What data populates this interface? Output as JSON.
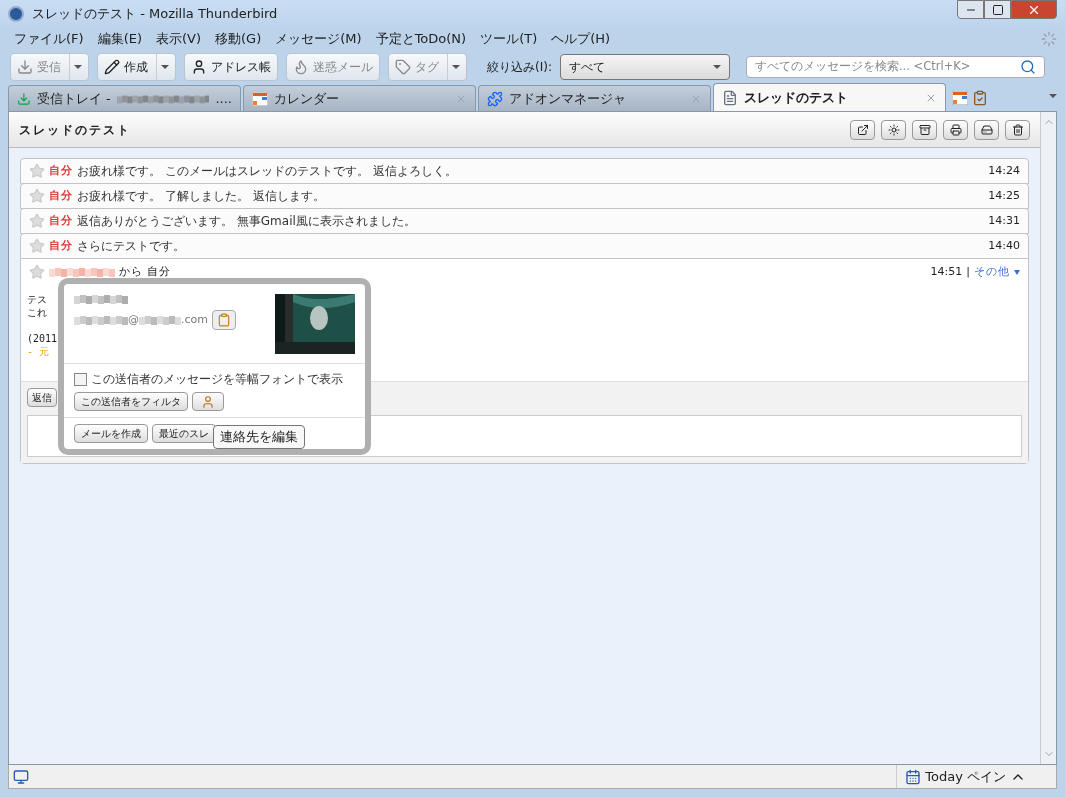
{
  "window": {
    "title": "スレッドのテスト - Mozilla Thunderbird"
  },
  "menu": [
    "ファイル(F)",
    "編集(E)",
    "表示(V)",
    "移動(G)",
    "メッセージ(M)",
    "予定とToDo(N)",
    "ツール(T)",
    "ヘルプ(H)"
  ],
  "toolbar": {
    "buttons": [
      {
        "kind": "get",
        "label": "受信",
        "disabled": true,
        "dropdown": true
      },
      {
        "kind": "write",
        "label": "作成",
        "disabled": false,
        "dropdown": true
      },
      {
        "kind": "address",
        "label": "アドレス帳",
        "disabled": false,
        "dropdown": false
      },
      {
        "kind": "junk",
        "label": "迷惑メール",
        "disabled": true,
        "dropdown": false
      },
      {
        "kind": "tag",
        "label": "タグ",
        "disabled": true,
        "dropdown": true
      }
    ],
    "filter_label": "絞り込み(I):",
    "filter_value": "すべて",
    "search_placeholder": "すべてのメッセージを検索... <Ctrl+K>"
  },
  "tabs": [
    {
      "kind": "inbox",
      "label": "受信トレイ -",
      "suffix": "....",
      "selected": false
    },
    {
      "kind": "calendar",
      "label": "カレンダー",
      "selected": false
    },
    {
      "kind": "addons",
      "label": "アドオンマネージャ",
      "selected": false
    },
    {
      "kind": "doc",
      "label": "スレッドのテスト",
      "selected": true
    }
  ],
  "thread": {
    "title": "スレッドのテスト",
    "messages": [
      {
        "sender": "自分",
        "snippet": "お疲れ様です。 このメールはスレッドのテストです。 返信よろしく。",
        "time": "14:24"
      },
      {
        "sender": "自分",
        "snippet": "お疲れ様です。 了解しました。 返信します。",
        "time": "14:25"
      },
      {
        "sender": "自分",
        "snippet": "返信ありがとうございます。 無事Gmail風に表示されました。",
        "time": "14:31"
      },
      {
        "sender": "自分",
        "snippet": "さらにテストです。",
        "time": "14:40"
      }
    ],
    "expanded": {
      "from_suffix": "から 自分",
      "time": "14:51",
      "more": "その他",
      "separator": "|",
      "paragraphs": [
        [
          "テス",
          "これ"
        ],
        [
          "(2011"
        ]
      ],
      "quote": "- 元",
      "reply_button": "返信"
    }
  },
  "popup": {
    "email_at": "@",
    "email_domain_end": ".com",
    "checkbox": {
      "label": "この送信者のメッセージを等幅フォントで表示",
      "checked": false
    },
    "filter_button": "この送信者をフィルタ",
    "buttons": [
      "メールを作成",
      "最近のスレ"
    ],
    "tooltip": "連絡先を編集"
  },
  "status_bar": {
    "today_pane": "Today ペイン"
  }
}
